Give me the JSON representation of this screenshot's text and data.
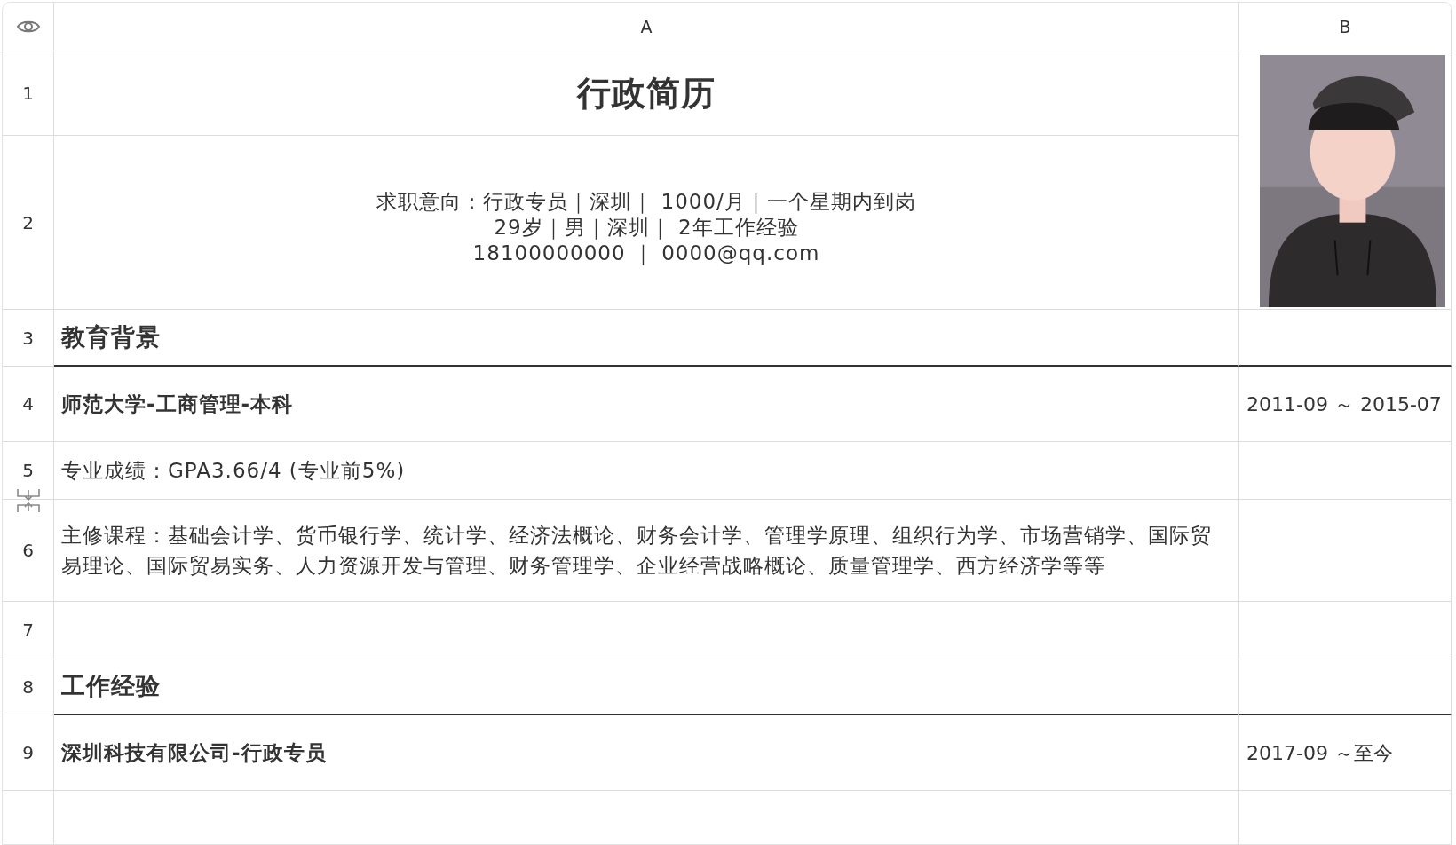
{
  "columns": [
    {
      "label": "A"
    },
    {
      "label": "B"
    }
  ],
  "rows": [
    {
      "number": "1",
      "kind": "title",
      "a": "行政简历"
    },
    {
      "number": "2",
      "kind": "info",
      "lines": [
        "求职意向：行政专员｜深圳｜ 1000/月｜一个星期内到岗",
        "29岁｜男｜深圳｜ 2年工作经验",
        "18100000000 ｜ 0000@qq.com"
      ]
    },
    {
      "number": "3",
      "kind": "heading",
      "a": "教育背景"
    },
    {
      "number": "4",
      "kind": "entry",
      "a": "师范大学-工商管理-本科",
      "b": "2011-09 ～ 2015-07"
    },
    {
      "number": "5",
      "kind": "text",
      "a": "专业成绩：GPA3.66/4 (专业前5%)"
    },
    {
      "number": "6",
      "kind": "text",
      "a": "主修课程：基础会计学、货币银行学、统计学、经济法概论、财务会计学、管理学原理、组织行为学、市场营销学、国际贸易理论、国际贸易实务、人力资源开发与管理、财务管理学、企业经营战略概论、质量管理学、西方经济学等等"
    },
    {
      "number": "7",
      "kind": "blank"
    },
    {
      "number": "8",
      "kind": "heading",
      "a": "工作经验"
    },
    {
      "number": "9",
      "kind": "entry",
      "a": "深圳科技有限公司-行政专员",
      "b": "2017-09 ～至今"
    }
  ]
}
